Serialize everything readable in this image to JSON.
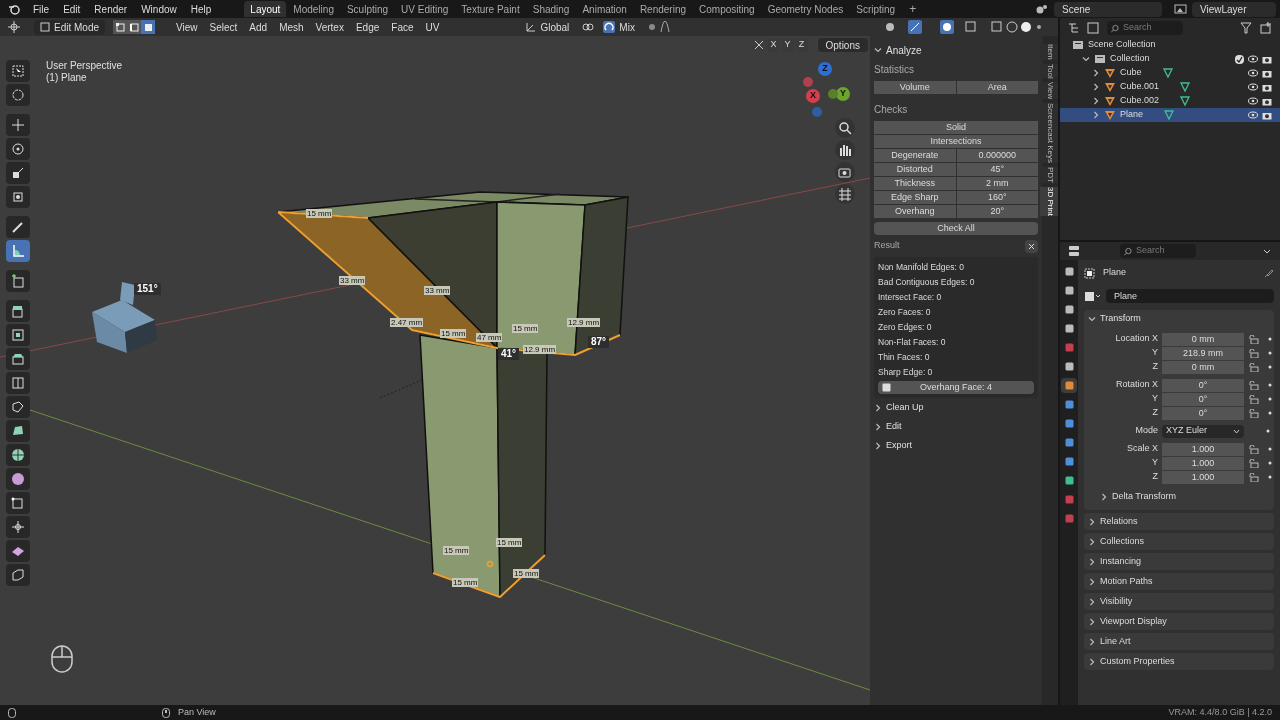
{
  "menu": [
    "File",
    "Edit",
    "Render",
    "Window",
    "Help"
  ],
  "workspaces": [
    {
      "label": "Layout",
      "selected": true
    },
    {
      "label": "Modeling",
      "selected": false
    },
    {
      "label": "Sculpting",
      "selected": false
    },
    {
      "label": "UV Editing",
      "selected": false
    },
    {
      "label": "Texture Paint",
      "selected": false
    },
    {
      "label": "Shading",
      "selected": false
    },
    {
      "label": "Animation",
      "selected": false
    },
    {
      "label": "Rendering",
      "selected": false
    },
    {
      "label": "Compositing",
      "selected": false
    },
    {
      "label": "Geometry Nodes",
      "selected": false
    },
    {
      "label": "Scripting",
      "selected": false
    }
  ],
  "add_workspace": "+",
  "scene": "Scene",
  "view_layer": "ViewLayer",
  "viewport_header": {
    "mode": "Edit Mode",
    "select_modes": [
      {
        "selected": false
      },
      {
        "selected": false
      },
      {
        "selected": true
      }
    ],
    "menus": [
      "View",
      "Select",
      "Add",
      "Mesh",
      "Vertex",
      "Edge",
      "Face",
      "UV"
    ],
    "orientation": "Global",
    "snap": "Mix",
    "axes": [
      "X",
      "Y",
      "Z"
    ],
    "options": "Options"
  },
  "viewport": {
    "view_name": "User Perspective",
    "object": "(1) Plane",
    "tools": [
      {
        "selected": false
      },
      {
        "selected": false
      },
      {
        "selected": false
      },
      {
        "selected": false
      },
      {
        "selected": false
      },
      {
        "selected": false
      },
      {
        "selected": false
      },
      {
        "selected": true
      },
      {
        "selected": false
      },
      {
        "selected": false
      },
      {
        "selected": false
      },
      {
        "selected": false
      },
      {
        "selected": false
      },
      {
        "selected": false
      },
      {
        "selected": false
      },
      {
        "selected": false
      },
      {
        "selected": false
      },
      {
        "selected": false
      },
      {
        "selected": false
      },
      {
        "selected": false
      },
      {
        "selected": false
      }
    ],
    "gizmo": [
      "Z",
      "Y",
      "X"
    ],
    "measurements": [
      "15 mm",
      "33 mm",
      "33 mm",
      "2.47 mm",
      "15 mm",
      "47 mm",
      "15 mm",
      "12.9 mm",
      "12.9 mm",
      "15 mm",
      "15 mm",
      "15 mm",
      "15 mm"
    ],
    "angles": [
      "151°",
      "41°",
      "87°"
    ]
  },
  "sidebar": {
    "tabs": [
      {
        "label": "Item",
        "selected": false
      },
      {
        "label": "Tool",
        "selected": false
      },
      {
        "label": "View",
        "selected": false
      },
      {
        "label": "Screencast Keys",
        "selected": false
      },
      {
        "label": "PDT",
        "selected": false
      },
      {
        "label": "3D Print",
        "selected": true
      }
    ],
    "panel": {
      "title": "Analyze",
      "expanded": true,
      "statistics_label": "Statistics",
      "statistics": [
        "Volume",
        "Area"
      ],
      "checks_label": "Checks",
      "checks_full": [
        "Solid",
        "Intersections"
      ],
      "checks": [
        {
          "label": "Degenerate",
          "value": "0.000000"
        },
        {
          "label": "Distorted",
          "value": "45°"
        },
        {
          "label": "Thickness",
          "value": "2 mm"
        },
        {
          "label": "Edge Sharp",
          "value": "160°"
        },
        {
          "label": "Overhang",
          "value": "20°"
        }
      ],
      "check_all": "Check All",
      "result_label": "Result",
      "results": [
        "Non Manifold Edges: 0",
        "Bad Contiguous Edges: 0",
        "Intersect Face: 0",
        "Zero Faces: 0",
        "Zero Edges: 0",
        "Non-Flat Faces: 0",
        "Thin Faces: 0",
        "Sharp Edge: 0"
      ],
      "overhang_result": "Overhang Face: 4"
    },
    "sections": [
      {
        "title": "Clean Up",
        "expanded": false
      },
      {
        "title": "Edit",
        "expanded": false
      },
      {
        "title": "Export",
        "expanded": false
      }
    ]
  },
  "outliner": {
    "search_placeholder": "Search",
    "tree": [
      {
        "label": "Scene Collection",
        "kind": "scene",
        "children": [
          {
            "label": "Collection",
            "kind": "collection",
            "expanded": true,
            "checked": true,
            "selected": false,
            "children": [
              {
                "label": "Cube",
                "kind": "mesh",
                "selected": false
              },
              {
                "label": "Cube.001",
                "kind": "mesh",
                "selected": false
              },
              {
                "label": "Cube.002",
                "kind": "mesh",
                "selected": false
              },
              {
                "label": "Plane",
                "kind": "mesh",
                "selected": true
              }
            ]
          }
        ]
      }
    ]
  },
  "properties": {
    "search_placeholder": "Search",
    "breadcrumb": "Plane",
    "object_name": "Plane",
    "tabs": [
      {
        "selected": false
      },
      {
        "selected": false
      },
      {
        "selected": false
      },
      {
        "selected": false
      },
      {
        "selected": false
      },
      {
        "selected": false
      },
      {
        "selected": true
      },
      {
        "selected": false
      },
      {
        "selected": false
      },
      {
        "selected": false
      },
      {
        "selected": false
      },
      {
        "selected": false
      },
      {
        "selected": false
      },
      {
        "selected": false
      }
    ],
    "transform": {
      "title": "Transform",
      "expanded": true,
      "location": [
        {
          "label": "Location X",
          "value": "0 mm"
        },
        {
          "label": "Y",
          "value": "218.9 mm"
        },
        {
          "label": "Z",
          "value": "0 mm"
        }
      ],
      "rotation": [
        {
          "label": "Rotation X",
          "value": "0°"
        },
        {
          "label": "Y",
          "value": "0°"
        },
        {
          "label": "Z",
          "value": "0°"
        }
      ],
      "mode_label": "Mode",
      "mode": "XYZ Euler",
      "scale": [
        {
          "label": "Scale X",
          "value": "1.000"
        },
        {
          "label": "Y",
          "value": "1.000"
        },
        {
          "label": "Z",
          "value": "1.000"
        }
      ],
      "delta": {
        "title": "Delta Transform",
        "expanded": false
      }
    },
    "sections": [
      {
        "title": "Relations",
        "expanded": false
      },
      {
        "title": "Collections",
        "expanded": false
      },
      {
        "title": "Instancing",
        "expanded": false
      },
      {
        "title": "Motion Paths",
        "expanded": false
      },
      {
        "title": "Visibility",
        "expanded": false
      },
      {
        "title": "Viewport Display",
        "expanded": false
      },
      {
        "title": "Line Art",
        "expanded": false
      },
      {
        "title": "Custom Properties",
        "expanded": false
      }
    ]
  },
  "status_bar": {
    "hint": "Pan View",
    "info": "VRAM: 4.4/8.0 GiB | 4.2.0"
  }
}
